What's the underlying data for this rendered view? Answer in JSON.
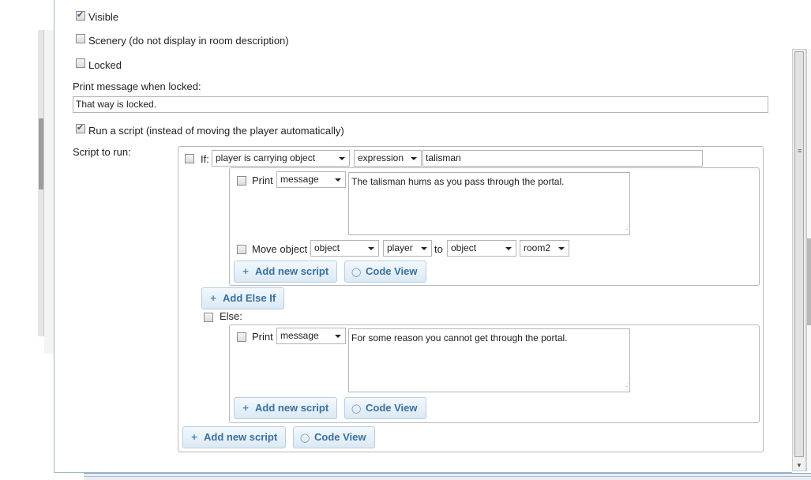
{
  "checkboxes": {
    "visible": {
      "label": "Visible",
      "checked": true
    },
    "scenery": {
      "label": "Scenery (do not display in room description)",
      "checked": false
    },
    "locked": {
      "label": "Locked",
      "checked": false
    },
    "run_script": {
      "label": "Run a script (instead of moving the player automatically)",
      "checked": true
    }
  },
  "locked_message": {
    "label": "Print message when locked:",
    "value": "That way is locked."
  },
  "script": {
    "label": "Script to run:",
    "if_block": {
      "if_label": "If:",
      "condition_select": "player is carrying object",
      "mode_select": "expression",
      "expression_value": "talisman",
      "print": {
        "label": "Print",
        "type_select": "message",
        "text": "The talisman hums as you pass through the portal."
      },
      "move": {
        "label": "Move object",
        "object_type_select": "object",
        "object_select": "player",
        "to_label": "to",
        "dest_type_select": "object",
        "dest_select": "room2"
      },
      "add_new_script": "Add new script",
      "code_view": "Code View"
    },
    "add_else_if": "Add Else If",
    "else_block": {
      "else_label": "Else:",
      "print": {
        "label": "Print",
        "type_select": "message",
        "text": "For some reason you cannot get through the portal."
      },
      "add_new_script": "Add new script",
      "code_view": "Code View"
    },
    "add_new_script": "Add new script",
    "code_view": "Code View"
  },
  "icons": {
    "plus": "plus-icon",
    "code": "code-view-icon",
    "resize": "resize-grip-icon"
  },
  "colors": {
    "button_text": "#3a6f9f",
    "button_bg": "#dbe9f5",
    "panel_border": "#b9b9b9",
    "accent_border": "#9fb8d1"
  }
}
